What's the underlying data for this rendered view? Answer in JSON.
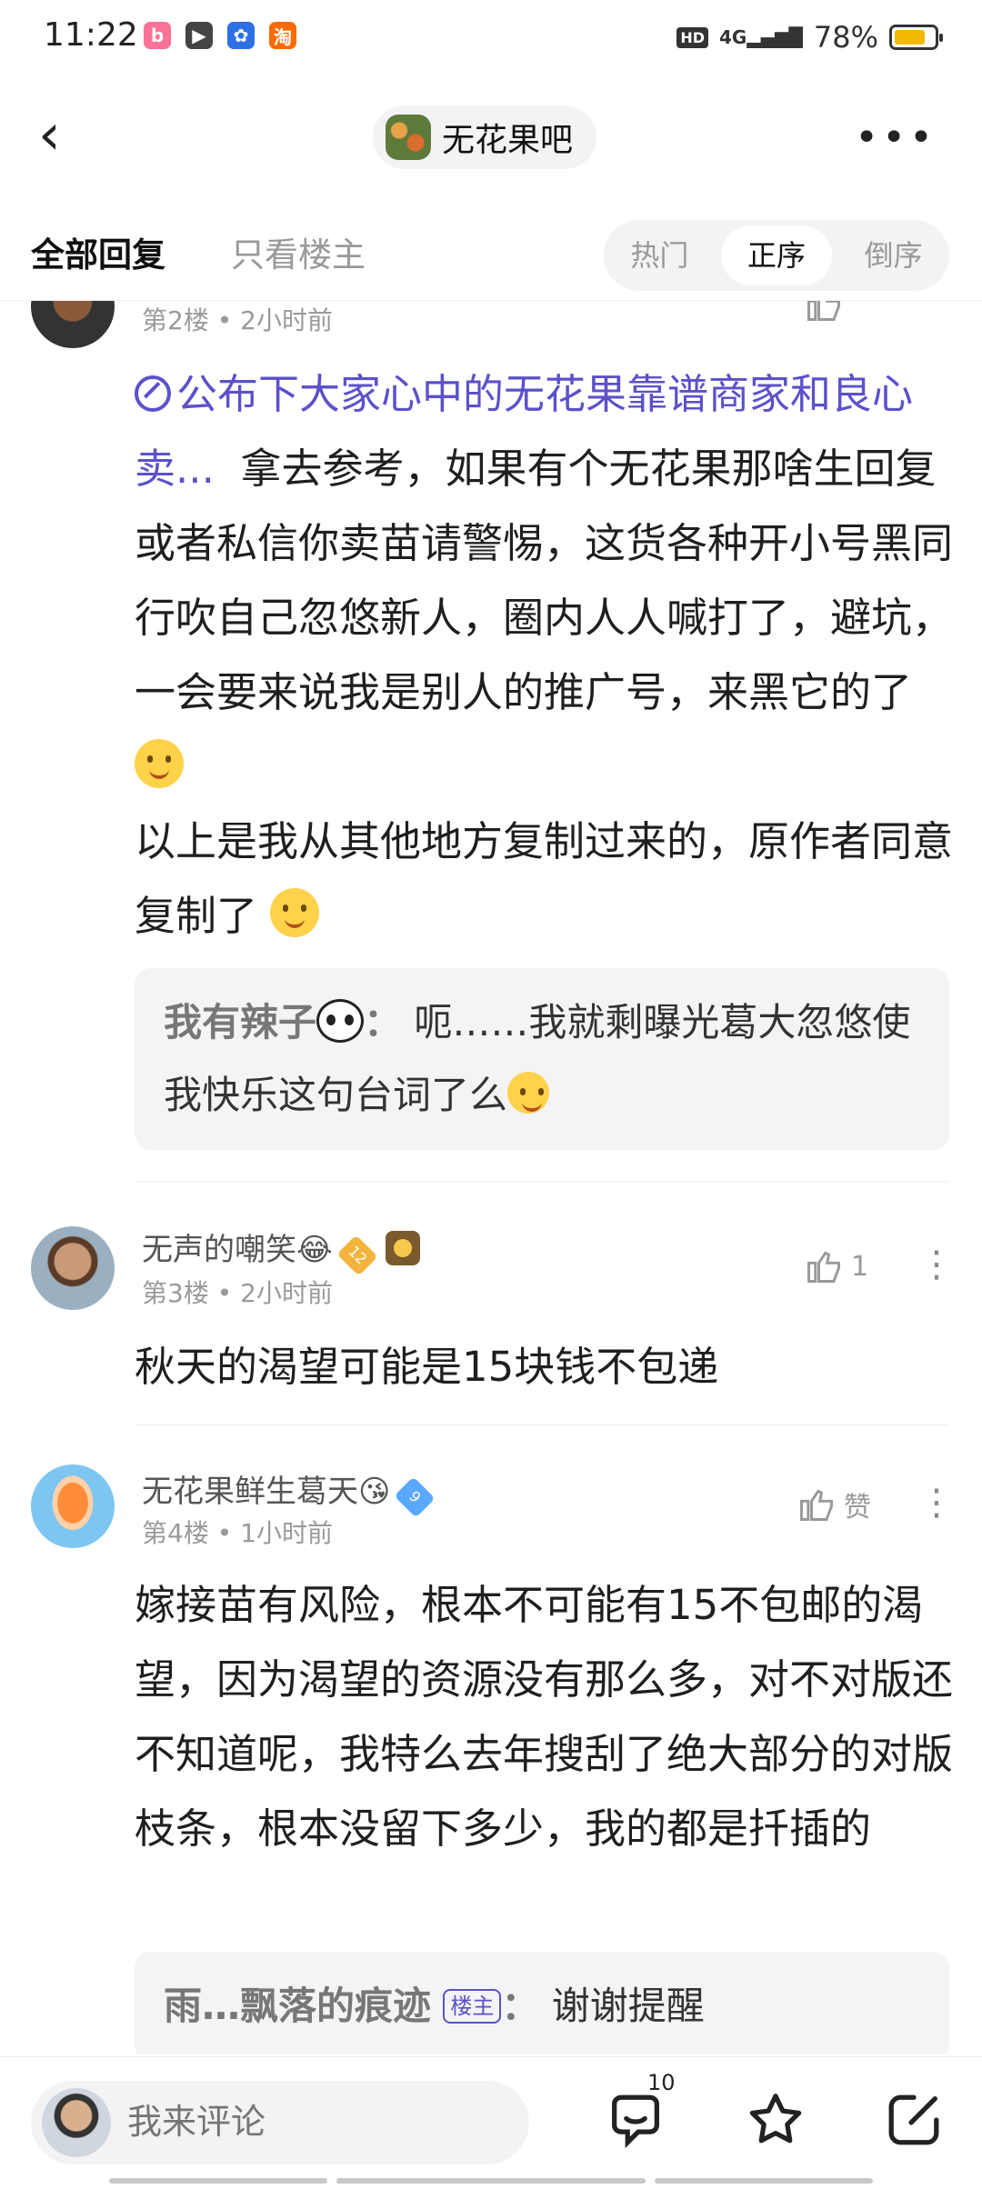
{
  "status_bar": {
    "time": "11:22",
    "network_hd": "HD",
    "network_type": "4G",
    "battery_percent": "78%",
    "battery_level": 0.78,
    "app_icons": [
      "bilibili-icon",
      "video-player-icon",
      "baidu-icon",
      "taobao-icon"
    ]
  },
  "header": {
    "forum_name": "无花果吧"
  },
  "tabs": {
    "all_replies": "全部回复",
    "op_only": "只看楼主",
    "sort_hot": "热门",
    "sort_asc": "正序",
    "sort_desc": "倒序",
    "active_sort": "正序"
  },
  "posts": [
    {
      "floor": "第2楼",
      "time": "2小时前",
      "link_text": "公布下大家心中的无花果靠谱商家和良心卖...",
      "body_1": "拿去参考，如果有个无花果那啥生回复或者私信你卖苗请警惕，这货各种开小号黑同行吹自己忽悠新人，圈内人人喊打了，避坑，一会要来说我是别人的推广号，来黑它的了",
      "body_2": "以上是我从其他地方复制过来的，原作者同意复制了",
      "reply": {
        "name": "我有辣子",
        "sep": "：",
        "text": "呃……我就剩曝光葛大忽悠使我快乐这句台词了么"
      }
    },
    {
      "username": "无声的嘲笑😂",
      "level": "12",
      "floor": "第3楼",
      "time": "2小时前",
      "likes": "1",
      "body": "秋天的渴望可能是15块钱不包递"
    },
    {
      "username": "无花果鲜生葛天😘",
      "level": "9",
      "floor": "第4楼",
      "time": "1小时前",
      "likes": "赞",
      "body": "嫁接苗有风险，根本不可能有15不包邮的渴望，因为渴望的资源没有那么多，对不对版还不知道呢，我特么去年搜刮了绝大部分的对版枝条，根本没留下多少，我的都是扦插的",
      "reply": {
        "name": "雨…飘落的痕迹",
        "badge": "楼主",
        "sep": "：",
        "text": "谢谢提醒"
      }
    }
  ],
  "bottom_bar": {
    "comment_placeholder": "我来评论",
    "reply_count": "10"
  },
  "colors": {
    "link": "#5b51c9",
    "muted": "#9a9a9a",
    "quote_bg": "#f4f4f6"
  }
}
